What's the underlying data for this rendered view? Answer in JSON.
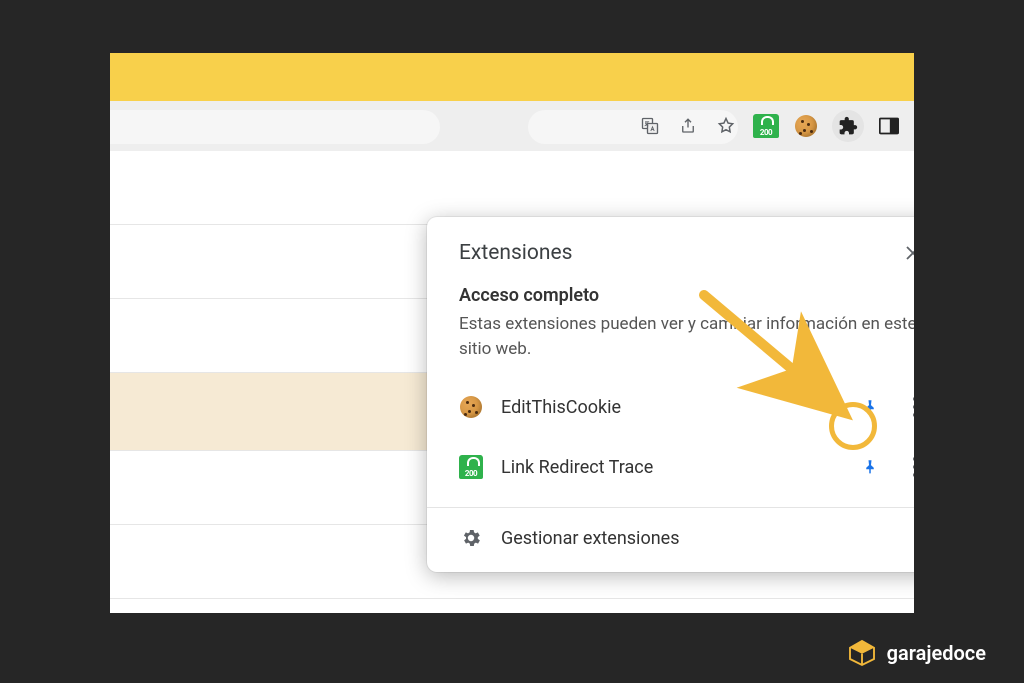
{
  "popup": {
    "title": "Extensiones",
    "section_title": "Acceso completo",
    "section_desc": "Estas extensiones pueden ver y cambiar información en este sitio web.",
    "items": [
      {
        "name": "EditThisCookie",
        "icon": "cookie-icon",
        "link_badge_text": ""
      },
      {
        "name": "Link Redirect Trace",
        "icon": "linkredirect-icon",
        "link_badge_text": "200"
      }
    ],
    "manage_label": "Gestionar extensiones"
  },
  "toolbar": {
    "icons": [
      "translate-icon",
      "share-icon",
      "star-icon",
      "linkredirect-ext-icon",
      "cookie-ext-icon",
      "extensions-puzzle-icon",
      "reader-mode-icon"
    ],
    "linkredirect_badge_text": "200"
  },
  "watermark": {
    "text": "garajedoce"
  },
  "colors": {
    "accent_yellow": "#f8d04b",
    "highlight_border": "#f2b83a",
    "pin_blue": "#1a73e8",
    "brand_green": "#2fb24c"
  }
}
